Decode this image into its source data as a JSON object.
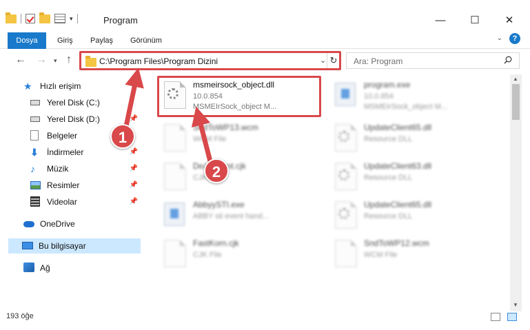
{
  "window": {
    "title": "Program",
    "minimize": "—",
    "maximize": "☐",
    "close": "✕"
  },
  "ribbon": {
    "tabs": [
      "Dosya",
      "Giriş",
      "Paylaş",
      "Görünüm"
    ],
    "help": "?"
  },
  "navbar": {
    "address": "C:\\Program Files\\Program Dizini",
    "search_placeholder": "Ara: Program"
  },
  "sidebar": {
    "items": [
      {
        "label": "Hızlı erişim",
        "icon": "star-icon"
      },
      {
        "label": "Yerel Disk (C:)",
        "icon": "drive-icon"
      },
      {
        "label": "Yerel Disk (D:)",
        "icon": "drive-icon"
      },
      {
        "label": "Belgeler",
        "icon": "documents-icon"
      },
      {
        "label": "İndirmeler",
        "icon": "downloads-icon"
      },
      {
        "label": "Müzik",
        "icon": "music-icon"
      },
      {
        "label": "Resimler",
        "icon": "pictures-icon"
      },
      {
        "label": "Videolar",
        "icon": "videos-icon"
      },
      {
        "label": "OneDrive",
        "icon": "onedrive-icon"
      },
      {
        "label": "Bu bilgisayar",
        "icon": "this-pc-icon"
      },
      {
        "label": "Ağ",
        "icon": "network-icon"
      }
    ]
  },
  "files": [
    {
      "name": "msmeirsock_object.dll",
      "line2": "10.0.854",
      "line3": "MSMEIrSock_object M...",
      "highlighted": true
    },
    {
      "name": "program.exe",
      "line2": "10.0.854",
      "line3": "MSMEIrSock_object M...",
      "blurred": true
    },
    {
      "name": "SndToWP13.wcm",
      "line2": "WCM File",
      "blurred": true
    },
    {
      "name": "UpdateClient65.dll",
      "line2": "Resource DLL",
      "blurred": true
    },
    {
      "name": "DeAccount.cjk",
      "line2": "CJK File",
      "blurred": true
    },
    {
      "name": "UpdateClient63.dll",
      "line2": "Resource DLL",
      "blurred": true
    },
    {
      "name": "AbbyySTI.exe",
      "line2": "ABBY sti event hand...",
      "blurred": true
    },
    {
      "name": "UpdateClient65.dll",
      "line2": "Resource DLL",
      "blurred": true
    },
    {
      "name": "FastKorn.cjk",
      "line2": "CJK File",
      "blurred": true
    },
    {
      "name": "SndToWP12.wcm",
      "line2": "WCM File",
      "blurred": true
    }
  ],
  "status": {
    "count": "193 öğe"
  },
  "callouts": [
    "1",
    "2"
  ],
  "colors": {
    "accent": "#1979ca",
    "highlight": "#d9484a",
    "selected": "#cce8ff"
  }
}
